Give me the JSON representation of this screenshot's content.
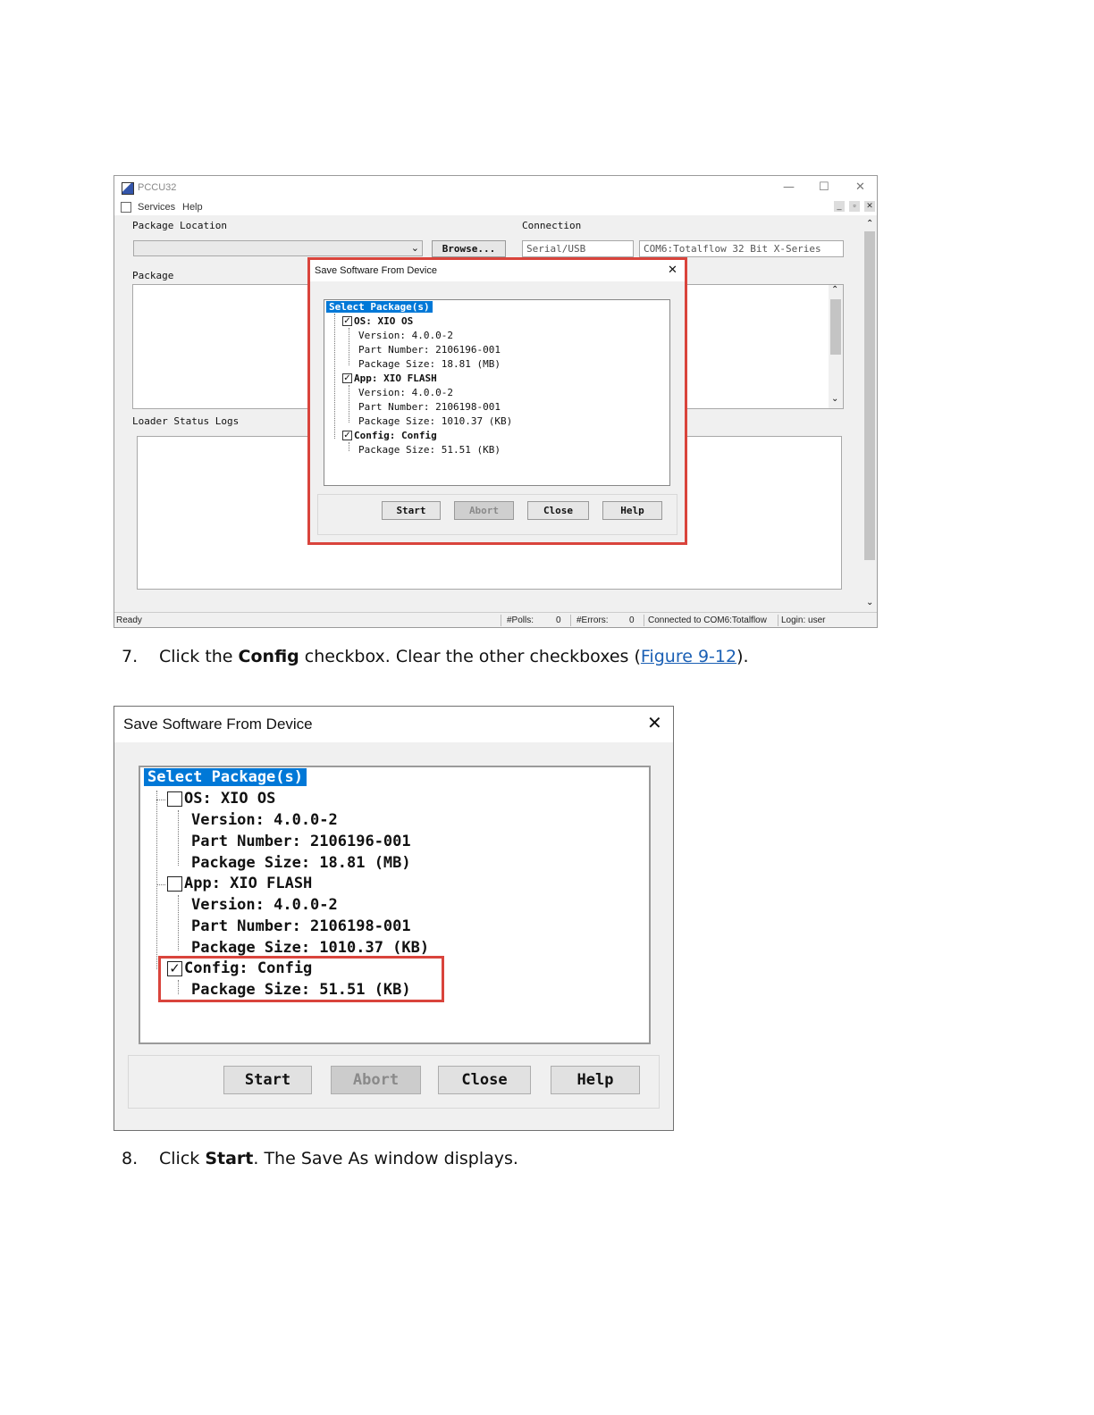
{
  "app": {
    "title": "PCCU32",
    "menu": [
      "Services",
      "Help"
    ],
    "window_controls": {
      "minimize": "—",
      "maximize": "☐",
      "close": "✕"
    },
    "package_location": {
      "label": "Package Location",
      "browse_label": "Browse..."
    },
    "connection": {
      "label": "Connection",
      "type": "Serial/USB",
      "device": "COM6:Totalflow 32 Bit X-Series"
    },
    "package_label": "Package",
    "loader_status_label": "Loader Status Logs",
    "status": {
      "ready": "Ready",
      "polls_label": "#Polls:",
      "polls_value": "0",
      "errors_label": "#Errors:",
      "errors_value": "0",
      "connected": "Connected to COM6:Totalflow",
      "login": "Login: user"
    }
  },
  "dialog": {
    "title": "Save Software From Device",
    "close_glyph": "✕",
    "tree_header": "Select Package(s)",
    "packages": [
      {
        "label": "OS: XIO OS",
        "details": [
          "Version: 4.0.0-2",
          "Part Number: 2106196-001",
          "Package Size: 18.81 (MB)"
        ]
      },
      {
        "label": "App: XIO FLASH",
        "details": [
          "Version: 4.0.0-2",
          "Part Number: 2106198-001",
          "Package Size: 1010.37 (KB)"
        ]
      },
      {
        "label": "Config: Config",
        "details": [
          "Package Size: 51.51 (KB)"
        ]
      }
    ],
    "buttons": {
      "start": "Start",
      "abort": "Abort",
      "close": "Close",
      "help": "Help"
    },
    "checked_before": [
      true,
      true,
      true
    ],
    "checked_after": [
      false,
      false,
      true
    ],
    "check_glyph": "✓"
  },
  "steps": {
    "step7": {
      "num": "7.",
      "pre": "Click the ",
      "bold": "Config",
      "mid": " checkbox. Clear the other checkboxes (",
      "link": "Figure 9-12",
      "post": ")."
    },
    "step8": {
      "num": "8.",
      "pre": "Click ",
      "bold": "Start",
      "post": ". The Save As window displays."
    }
  },
  "colors": {
    "highlight_red": "#d9443c",
    "selection_blue": "#0078d7",
    "link": "#1a5fb4"
  }
}
